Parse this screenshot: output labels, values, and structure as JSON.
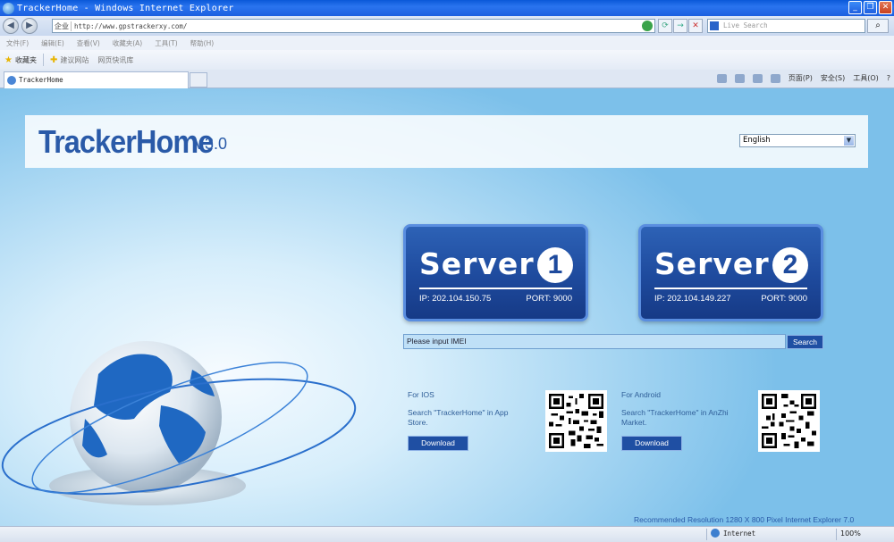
{
  "window": {
    "title": "TrackerHome - Windows Internet Explorer",
    "controls": [
      "_",
      "❐",
      "✕"
    ]
  },
  "address_bar": {
    "zone": "企业",
    "url": "http://www.gpstrackerxy.com/",
    "search_placeholder": "Live Search"
  },
  "menu": [
    "文件(F)",
    "编辑(E)",
    "查看(V)",
    "收藏夹(A)",
    "工具(T)",
    "帮助(H)"
  ],
  "favorites_bar": {
    "favorites_label": "收藏夹",
    "suggested_sites": "建议网站",
    "web_slice_gallery": "网页快讯库"
  },
  "tab": {
    "label": "TrackerHome"
  },
  "command_bar": {
    "page": "页面(P)",
    "safety": "安全(S)",
    "tools": "工具(O)",
    "help": "?"
  },
  "page": {
    "logo": "TrackerHome",
    "version": "V3.0",
    "language": {
      "selected": "English"
    },
    "servers": [
      {
        "name": "Server",
        "number": "1",
        "ip": "IP: 202.104.150.75",
        "port": "PORT: 9000"
      },
      {
        "name": "Server",
        "number": "2",
        "ip": "IP: 202.104.149.227",
        "port": "PORT: 9000"
      }
    ],
    "imei_placeholder": "Please input IMEI",
    "search_button": "Search",
    "ios": {
      "title": "For IOS",
      "text": "Search \"TrackerHome\" in App Store.",
      "button": "Download"
    },
    "android": {
      "title": "For Android",
      "text": "Search \"TrackerHome\" in AnZhi Market.",
      "button": "Download"
    },
    "recommendation": "Recommended Resolution 1280 X 800 Pixel Internet Explorer 7.0"
  },
  "status_bar": {
    "zone": "Internet",
    "zoom": "100%"
  }
}
